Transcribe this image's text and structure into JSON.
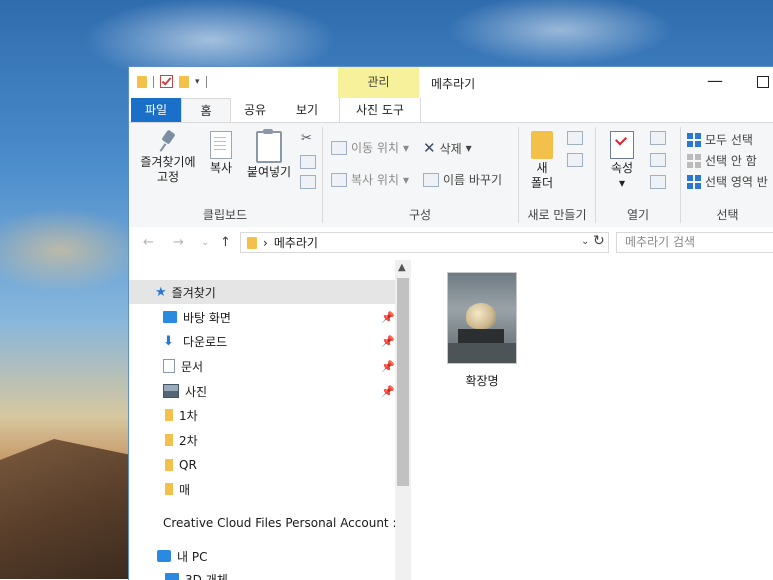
{
  "window": {
    "title": "메추라기",
    "context_tab": "관리",
    "controls": {
      "minimize": "—"
    }
  },
  "tabs": {
    "file": "파일",
    "home": "홈",
    "share": "공유",
    "view": "보기",
    "photo_tools": "사진 도구"
  },
  "ribbon": {
    "clipboard": {
      "label": "클립보드",
      "pin_line1": "즐겨찾기에",
      "pin_line2": "고정",
      "copy": "복사",
      "paste": "붙여넣기"
    },
    "organize": {
      "label": "구성",
      "move_to": "이동 위치",
      "copy_to": "복사 위치",
      "delete": "삭제",
      "rename": "이름 바꾸기"
    },
    "new": {
      "label": "새로 만들기",
      "new_folder_line1": "새",
      "new_folder_line2": "폴더"
    },
    "open": {
      "label": "열기",
      "properties": "속성"
    },
    "select": {
      "label": "선택",
      "select_all": "모두 선택",
      "select_none": "선택 안 함",
      "invert": "선택 영역 반"
    }
  },
  "address": {
    "separator": "›",
    "path": "메추라기",
    "search_placeholder": "메추라기 검색"
  },
  "nav": {
    "items": [
      {
        "label": "즐겨찾기",
        "icon": "star-icon",
        "selected": true
      },
      {
        "label": "바탕 화면",
        "icon": "desktop-icon",
        "pinned": true
      },
      {
        "label": "다운로드",
        "icon": "download-icon",
        "pinned": true
      },
      {
        "label": "문서",
        "icon": "document-icon",
        "pinned": true
      },
      {
        "label": "사진",
        "icon": "pictures-icon",
        "pinned": true
      },
      {
        "label": "1차",
        "icon": "folder-icon"
      },
      {
        "label": "2차",
        "icon": "folder-icon"
      },
      {
        "label": "QR",
        "icon": "folder-icon"
      },
      {
        "label": "매",
        "icon": "folder-icon"
      },
      {
        "label": "Creative Cloud Files Personal Account :",
        "icon": "folder-icon"
      },
      {
        "label": "내 PC",
        "icon": "pc-icon"
      },
      {
        "label": "3D 개체",
        "icon": "3d-objects-icon"
      }
    ]
  },
  "files": [
    {
      "name": "확장명",
      "type": "image"
    }
  ]
}
